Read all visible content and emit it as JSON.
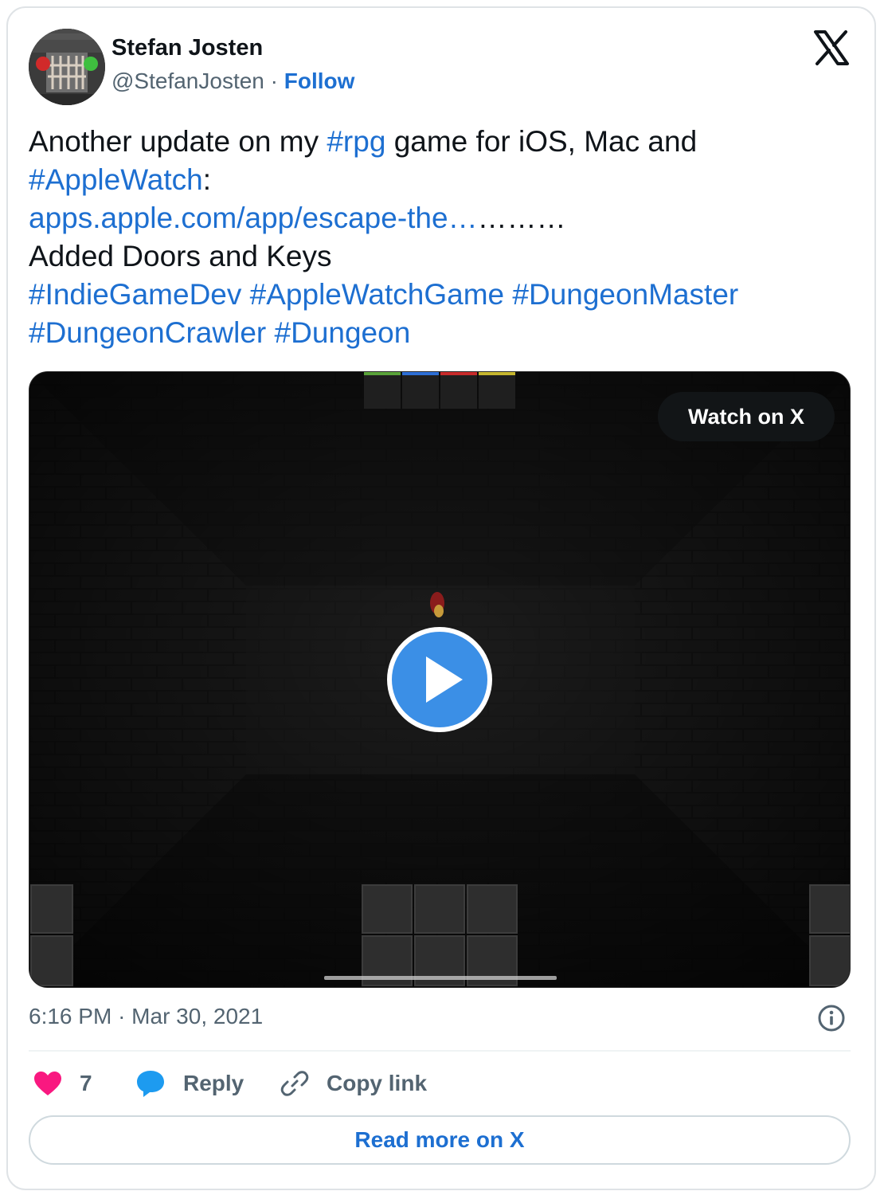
{
  "author": {
    "name": "Stefan Josten",
    "handle": "@StefanJosten",
    "separator": "·",
    "follow_label": "Follow",
    "avatar_icon": "dungeon-door-avatar"
  },
  "brand": {
    "logo_icon": "x-logo-icon"
  },
  "tweet": {
    "l1_a": "Another update on my ",
    "l1_tag": "#rpg",
    "l1_b": " game for iOS, Mac and",
    "l2_tag": "#AppleWatch",
    "l2_b": ":",
    "l3_link": "apps.apple.com/app/escape-the…",
    "l3_b": "………",
    "l4": "Added  Doors and Keys",
    "l5_tag1": "#IndieGameDev",
    "l5_tag2": "#AppleWatchGame",
    "l5_tag3": "#DungeonMaster",
    "l6_tag1": "#DungeonCrawler",
    "l6_tag2": "#Dungeon"
  },
  "media": {
    "watch_label": "Watch on X",
    "play_icon": "play-icon"
  },
  "meta": {
    "time": "6:16 PM",
    "separator": "·",
    "date": "Mar 30, 2021",
    "info_icon": "info-icon"
  },
  "actions": {
    "like_count": "7",
    "reply_label": "Reply",
    "copy_label": "Copy link"
  },
  "footer": {
    "read_more_label": "Read more on X"
  },
  "colors": {
    "link": "#1d6fd1",
    "like": "#f91880",
    "reply_icon": "#1d9bf0",
    "play_button": "#3b8fe6",
    "muted_text": "#536471"
  }
}
